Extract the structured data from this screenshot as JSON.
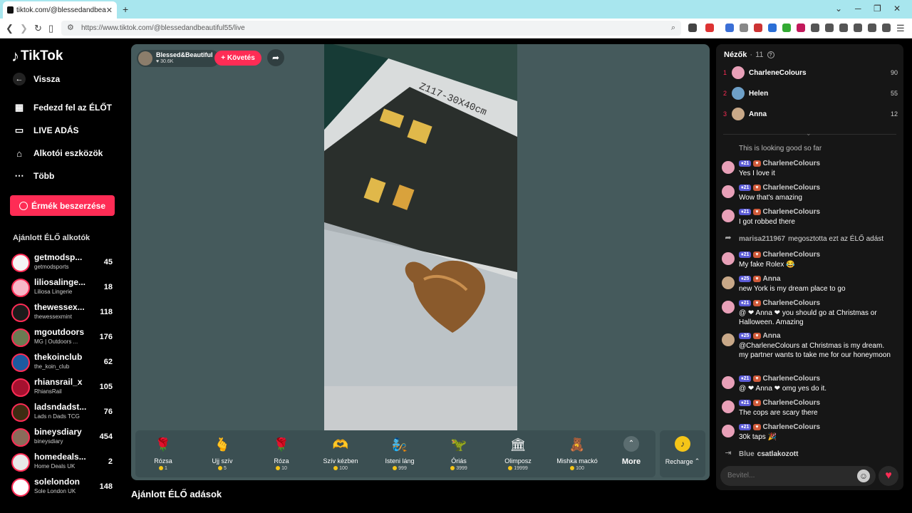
{
  "browser": {
    "tab_title": "tiktok.com/@blessedandbea",
    "url": "https://www.tiktok.com/@blessedandbeautiful55/live"
  },
  "sidebar": {
    "logo": "TikTok",
    "back": "Vissza",
    "nav": [
      {
        "label": "Fedezd fel az ÉLŐT",
        "icon": "calendar-icon"
      },
      {
        "label": "LIVE ADÁS",
        "icon": "video-camera-icon"
      },
      {
        "label": "Alkotói eszközök",
        "icon": "home-icon"
      },
      {
        "label": "Több",
        "icon": "more-dots-icon"
      }
    ],
    "coins_button": "Érmék beszerzése",
    "section_title": "Ajánlott ÉLŐ alkotók",
    "creators": [
      {
        "name": "getmodsp...",
        "sub": "getmodsports",
        "count": "45",
        "color": "#f4f4f4"
      },
      {
        "name": "liliosalinge...",
        "sub": "Liliosa Lingerie",
        "count": "18",
        "color": "#f7b7c8"
      },
      {
        "name": "thewessex...",
        "sub": "thewessexmint",
        "count": "118",
        "color": "#1b1b1b"
      },
      {
        "name": "mgoutdoors",
        "sub": "MG | Outdoors ...",
        "count": "176",
        "color": "#6b7b52"
      },
      {
        "name": "thekoinclub",
        "sub": "the_koin_club",
        "count": "62",
        "color": "#1c5aa0"
      },
      {
        "name": "rhiansrail_x",
        "sub": "RhiansRail",
        "count": "105",
        "color": "#a5112f"
      },
      {
        "name": "ladsndadst...",
        "sub": "Lads n Dads TCG",
        "count": "76",
        "color": "#3d2c12"
      },
      {
        "name": "bineysdiary",
        "sub": "bineysdiary",
        "count": "454",
        "color": "#8a6c5a"
      },
      {
        "name": "homedeals...",
        "sub": "Home Deals UK",
        "count": "2",
        "color": "#e8e8e8"
      },
      {
        "name": "solelondon",
        "sub": "Sole London UK",
        "count": "148",
        "color": "#ffffff"
      }
    ]
  },
  "stream": {
    "host_name": "Blessed&Beautiful",
    "host_likes": "30.6K",
    "follow_label": "+ Követés",
    "video_label": "Z117-30X40cm",
    "gifts": [
      {
        "name": "Rózsa",
        "price": "1",
        "icon": "🌹"
      },
      {
        "name": "Ujj szív",
        "price": "5",
        "icon": "🫰"
      },
      {
        "name": "Róza",
        "price": "10",
        "icon": "🌹"
      },
      {
        "name": "Szív kézben",
        "price": "100",
        "icon": "🫶"
      },
      {
        "name": "Isteni láng",
        "price": "999",
        "icon": "🧞"
      },
      {
        "name": "Óriás",
        "price": "3999",
        "icon": "🦖"
      },
      {
        "name": "Olimposz",
        "price": "19999",
        "icon": "🏛"
      },
      {
        "name": "Mishka mackó",
        "price": "100",
        "icon": "🧸"
      }
    ],
    "more_label": "More",
    "recharge_label": "Recharge",
    "recommended_title": "Ajánlott ÉLŐ adások"
  },
  "panel": {
    "viewers_title": "Nézők",
    "viewers_count": "11",
    "top_viewers": [
      {
        "rank": "1",
        "name": "CharleneColours",
        "score": "90",
        "color": "#e8a0b8"
      },
      {
        "rank": "2",
        "name": "Helen",
        "score": "55",
        "color": "#6ea0c8"
      },
      {
        "rank": "3",
        "name": "Anna",
        "score": "12",
        "color": "#c8a888"
      }
    ],
    "chat": [
      {
        "user": "",
        "text": "This is looking good so far",
        "level": "",
        "color": "#666"
      },
      {
        "user": "CharleneColours",
        "text": "Yes I love it",
        "level": "21",
        "color": "#e8a0b8"
      },
      {
        "user": "CharleneColours",
        "text": "Wow that's amazing",
        "level": "21",
        "color": "#e8a0b8"
      },
      {
        "user": "CharleneColours",
        "text": "I got robbed there",
        "level": "21",
        "color": "#e8a0b8"
      },
      {
        "user": "CharleneColours",
        "text": "My fake Rolex 😂",
        "level": "21",
        "color": "#e8a0b8"
      },
      {
        "user": "Anna",
        "text": "new York is my dream place to go",
        "level": "25",
        "color": "#c8a888"
      },
      {
        "user": "CharleneColours",
        "text": "@ ❤ Anna ❤ you should go at Christmas or Halloween. Amazing",
        "level": "21",
        "color": "#e8a0b8"
      },
      {
        "user": "Anna",
        "text": "@CharleneColours at Christmas is my dream. my partner wants to take me for our honeymoon",
        "level": "25",
        "color": "#c8a888"
      },
      {
        "user": "CharleneColours",
        "text": "@ ❤ Anna ❤ omg yes do it.",
        "level": "21",
        "color": "#e8a0b8"
      },
      {
        "user": "CharleneColours",
        "text": "The cops are scary there",
        "level": "21",
        "color": "#e8a0b8"
      },
      {
        "user": "CharleneColours",
        "text": "30k taps 🎉",
        "level": "21",
        "color": "#e8a0b8"
      }
    ],
    "share_user": "marisa211967",
    "share_text": "megosztotta ezt az ÉLŐ adást",
    "join_user": "Blue",
    "join_text": "csatlakozott",
    "input_placeholder": "Bevitel..."
  }
}
